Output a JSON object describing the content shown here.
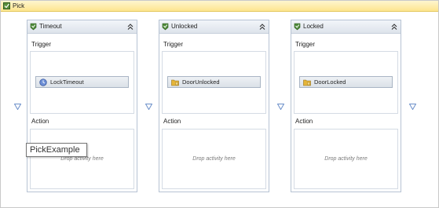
{
  "pick": {
    "title": "Pick"
  },
  "branches": [
    {
      "title": "Timeout",
      "trigger_label": "Trigger",
      "trigger_activity": "LockTimeout",
      "activity_icon": "clock-icon",
      "action_label": "Action",
      "drop_hint": "Drop activity here"
    },
    {
      "title": "Unlocked",
      "trigger_label": "Trigger",
      "trigger_activity": "DoorUnlocked",
      "activity_icon": "folder-icon",
      "action_label": "Action",
      "drop_hint": "Drop activity here"
    },
    {
      "title": "Locked",
      "trigger_label": "Trigger",
      "trigger_activity": "DoorLocked",
      "activity_icon": "folder-icon",
      "action_label": "Action",
      "drop_hint": "Drop activity here"
    }
  ],
  "tooltip": {
    "text": "PickExample"
  },
  "colors": {
    "header_bg": "#fde58f",
    "branch_border": "#b7c3d3",
    "arrow": "#6b8fc9"
  }
}
